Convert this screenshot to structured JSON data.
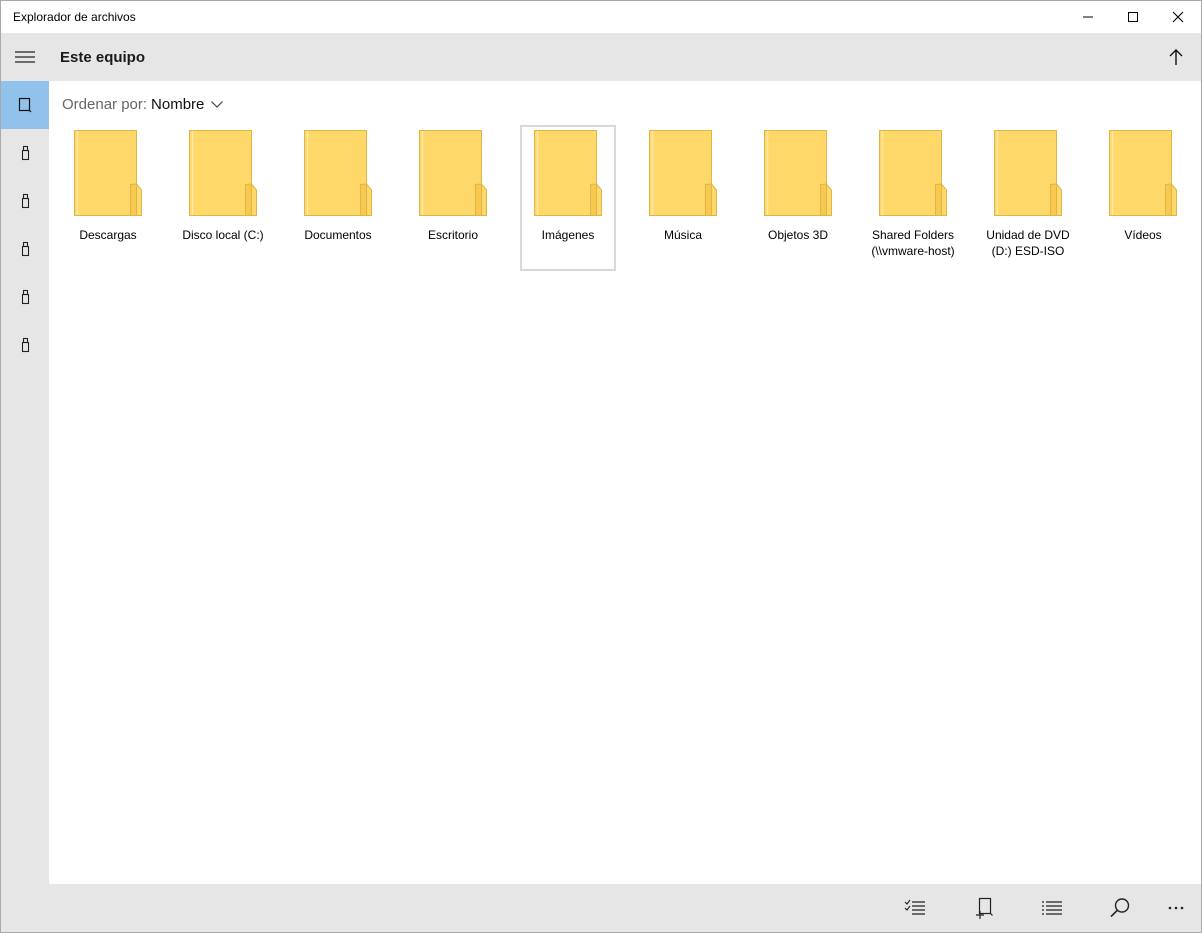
{
  "window": {
    "title": "Explorador de archivos"
  },
  "header": {
    "title": "Este equipo"
  },
  "sort": {
    "label": "Ordenar por:",
    "value": "Nombre"
  },
  "folders": [
    {
      "line1": "Descargas",
      "line2": ""
    },
    {
      "line1": "Disco local (C:)",
      "line2": ""
    },
    {
      "line1": "Documentos",
      "line2": ""
    },
    {
      "line1": "Escritorio",
      "line2": ""
    },
    {
      "line1": "Imágenes",
      "line2": ""
    },
    {
      "line1": "Música",
      "line2": ""
    },
    {
      "line1": "Objetos 3D",
      "line2": ""
    },
    {
      "line1": "Shared Folders",
      "line2": "(\\\\vmware-host)"
    },
    {
      "line1": "Unidad de DVD",
      "line2": "(D:) ESD-ISO"
    },
    {
      "line1": "Vídeos",
      "line2": ""
    }
  ],
  "selected_folder": "Imágenes",
  "icons": {
    "window_controls": [
      "minimize-icon",
      "maximize-icon",
      "close-icon"
    ],
    "rail": [
      "hamburger-menu-icon",
      "this-pc-icon",
      "drive-icon",
      "drive-icon",
      "drive-icon",
      "drive-icon",
      "drive-icon"
    ],
    "header": [
      "up-arrow-icon"
    ],
    "command_bar": [
      "select-icon",
      "new-folder-icon",
      "list-view-icon",
      "search-icon",
      "more-icon"
    ]
  },
  "colors": {
    "chrome_gray": "#e6e6e6",
    "rail_active": "#91c2ec",
    "folder_fill": "#ffd86a",
    "folder_edge": "#e0b446",
    "selection_border": "#d9d9d9"
  }
}
